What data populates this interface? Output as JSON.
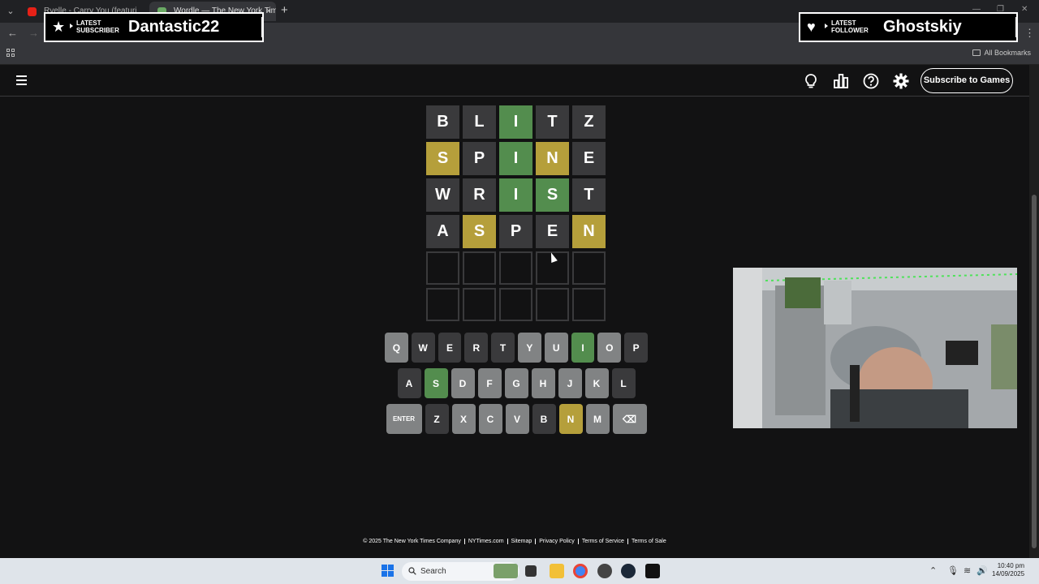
{
  "browser": {
    "tabs": [
      {
        "label": "Ryelle - Carry You (featuri",
        "active": false
      },
      {
        "label": "Wordle — The New York Times",
        "active": true
      }
    ],
    "new_tab": "+",
    "tab_close": "×",
    "all_bookmarks": "All Bookmarks"
  },
  "overlays": {
    "subscriber": {
      "label": "LATEST SUBSCRIBER",
      "name": "Dantastic22"
    },
    "follower": {
      "label": "LATEST FOLLOWER",
      "name": "Ghostskiy"
    }
  },
  "wordle": {
    "subscribe_label": "Subscribe to Games",
    "board": [
      [
        {
          "l": "B",
          "s": "absent"
        },
        {
          "l": "L",
          "s": "absent"
        },
        {
          "l": "I",
          "s": "correct"
        },
        {
          "l": "T",
          "s": "absent"
        },
        {
          "l": "Z",
          "s": "absent"
        }
      ],
      [
        {
          "l": "S",
          "s": "present"
        },
        {
          "l": "P",
          "s": "absent"
        },
        {
          "l": "I",
          "s": "correct"
        },
        {
          "l": "N",
          "s": "present"
        },
        {
          "l": "E",
          "s": "absent"
        }
      ],
      [
        {
          "l": "W",
          "s": "absent"
        },
        {
          "l": "R",
          "s": "absent"
        },
        {
          "l": "I",
          "s": "correct"
        },
        {
          "l": "S",
          "s": "correct"
        },
        {
          "l": "T",
          "s": "absent"
        }
      ],
      [
        {
          "l": "A",
          "s": "absent"
        },
        {
          "l": "S",
          "s": "present"
        },
        {
          "l": "P",
          "s": "absent"
        },
        {
          "l": "E",
          "s": "absent"
        },
        {
          "l": "N",
          "s": "present"
        }
      ],
      [
        {
          "l": "",
          "s": "empty"
        },
        {
          "l": "",
          "s": "empty"
        },
        {
          "l": "",
          "s": "empty"
        },
        {
          "l": "",
          "s": "empty"
        },
        {
          "l": "",
          "s": "empty"
        }
      ],
      [
        {
          "l": "",
          "s": "empty"
        },
        {
          "l": "",
          "s": "empty"
        },
        {
          "l": "",
          "s": "empty"
        },
        {
          "l": "",
          "s": "empty"
        },
        {
          "l": "",
          "s": "empty"
        }
      ]
    ],
    "keyboard": [
      [
        {
          "k": "Q",
          "s": "unused"
        },
        {
          "k": "W",
          "s": "absent"
        },
        {
          "k": "E",
          "s": "absent"
        },
        {
          "k": "R",
          "s": "absent"
        },
        {
          "k": "T",
          "s": "absent"
        },
        {
          "k": "Y",
          "s": "unused"
        },
        {
          "k": "U",
          "s": "unused"
        },
        {
          "k": "I",
          "s": "correct"
        },
        {
          "k": "O",
          "s": "unused"
        },
        {
          "k": "P",
          "s": "absent"
        }
      ],
      [
        {
          "k": "A",
          "s": "absent"
        },
        {
          "k": "S",
          "s": "correct"
        },
        {
          "k": "D",
          "s": "unused"
        },
        {
          "k": "F",
          "s": "unused"
        },
        {
          "k": "G",
          "s": "unused"
        },
        {
          "k": "H",
          "s": "unused"
        },
        {
          "k": "J",
          "s": "unused"
        },
        {
          "k": "K",
          "s": "unused"
        },
        {
          "k": "L",
          "s": "absent"
        }
      ],
      [
        {
          "k": "ENTER",
          "s": "unused",
          "wide": true
        },
        {
          "k": "Z",
          "s": "absent"
        },
        {
          "k": "X",
          "s": "unused"
        },
        {
          "k": "C",
          "s": "unused"
        },
        {
          "k": "V",
          "s": "unused"
        },
        {
          "k": "B",
          "s": "absent"
        },
        {
          "k": "N",
          "s": "present"
        },
        {
          "k": "M",
          "s": "unused"
        },
        {
          "k": "⌫",
          "s": "unused",
          "back": true
        }
      ]
    ],
    "colors": {
      "correct": "#538d4e",
      "present": "#b59f3b",
      "absent": "#3a3a3c",
      "unused": "#818384"
    }
  },
  "footer": {
    "links": [
      "© 2025 The New York Times Company",
      "NYTimes.com",
      "Sitemap",
      "Privacy Policy",
      "Terms of Service",
      "Terms of Sale"
    ]
  },
  "taskbar": {
    "search_placeholder": "Search",
    "time": "10:40 pm",
    "date": "14/09/2025"
  }
}
